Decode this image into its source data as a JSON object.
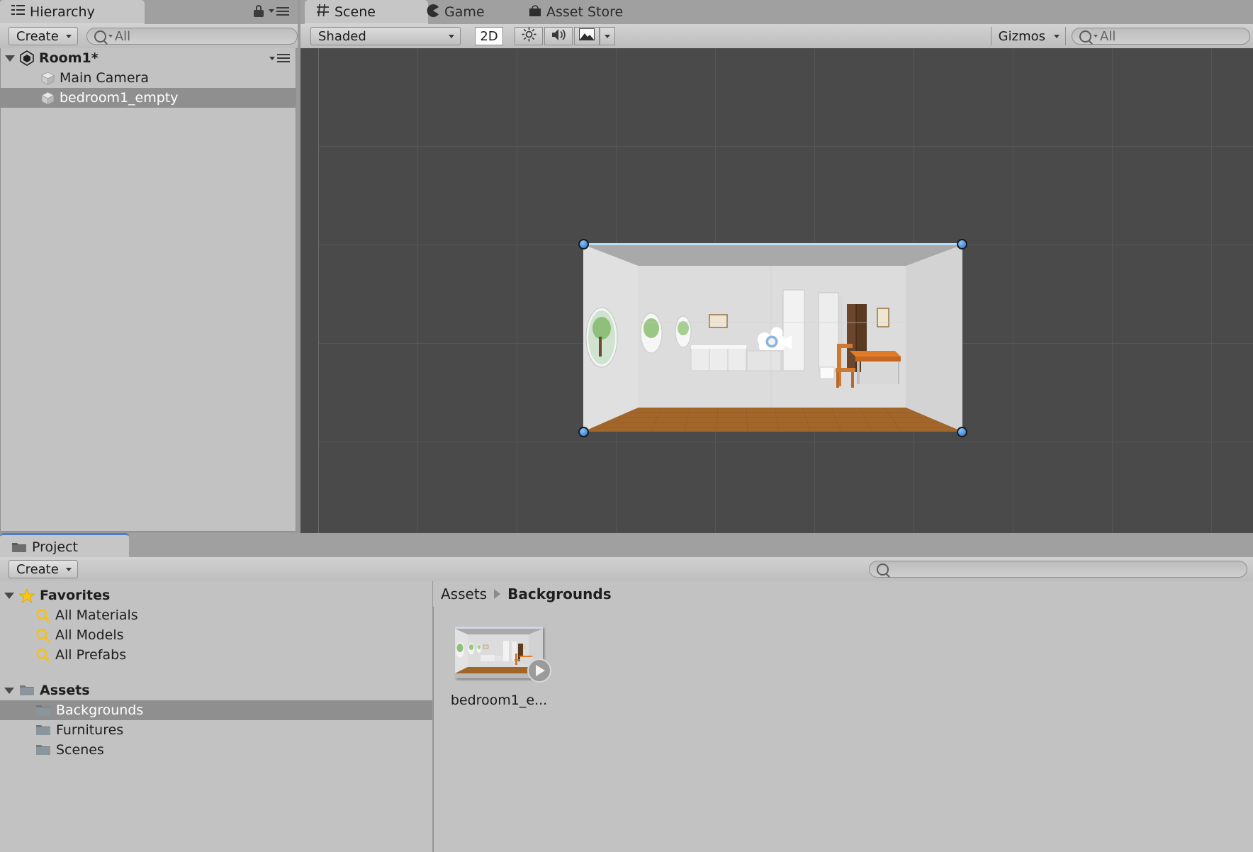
{
  "hierarchy": {
    "tab_label": "Hierarchy",
    "tab_icon": "hierarchy-icon",
    "lock_icon": "lock-icon",
    "menu_icon": "panel-menu-icon",
    "create_label": "Create",
    "search_placeholder": "All",
    "search_value": "",
    "scene_name": "Room1*",
    "items": [
      {
        "label": "Main Camera",
        "selected": false,
        "icon": "gameobject-cube-icon"
      },
      {
        "label": "bedroom1_empty",
        "selected": true,
        "icon": "gameobject-cube-icon"
      }
    ]
  },
  "scene": {
    "tabs": [
      {
        "label": "Scene",
        "icon": "grid-icon",
        "active": true
      },
      {
        "label": "Game",
        "icon": "pacman-icon",
        "active": false
      },
      {
        "label": "Asset Store",
        "icon": "store-bag-icon",
        "active": false
      }
    ],
    "toolbar": {
      "draw_mode": "Shaded",
      "mode_2d_label": "2D",
      "mode_2d_active": true,
      "lighting_icon": "sun-icon",
      "audio_icon": "speaker-icon",
      "effects_icon": "image-icon",
      "gizmos_label": "Gizmos",
      "search_placeholder": "All",
      "search_value": ""
    },
    "viewport": {
      "background_color": "#4a4a4a",
      "grid_color": "#565656",
      "selection_color": "#b9dcf7",
      "handle_color": "#1f6fd0",
      "camera_gizmo": "main-camera-gizmo",
      "selected_object": "bedroom1_empty"
    }
  },
  "project": {
    "tab_label": "Project",
    "tab_icon": "folder-icon",
    "create_label": "Create",
    "search_placeholder": "",
    "search_value": "",
    "favorites": {
      "label": "Favorites",
      "icon": "star-icon",
      "items": [
        {
          "label": "All Materials",
          "icon": "saved-search-icon"
        },
        {
          "label": "All Models",
          "icon": "saved-search-icon"
        },
        {
          "label": "All Prefabs",
          "icon": "saved-search-icon"
        }
      ]
    },
    "assets_tree": {
      "label": "Assets",
      "icon": "folder-icon",
      "items": [
        {
          "label": "Backgrounds",
          "icon": "folder-icon",
          "selected": true
        },
        {
          "label": "Furnitures",
          "icon": "folder-icon",
          "selected": false
        },
        {
          "label": "Scenes",
          "icon": "folder-icon",
          "selected": false
        }
      ]
    },
    "breadcrumb": {
      "root": "Assets",
      "current": "Backgrounds"
    },
    "grid_items": [
      {
        "label": "bedroom1_e...",
        "badge": "model-play-badge"
      }
    ]
  }
}
